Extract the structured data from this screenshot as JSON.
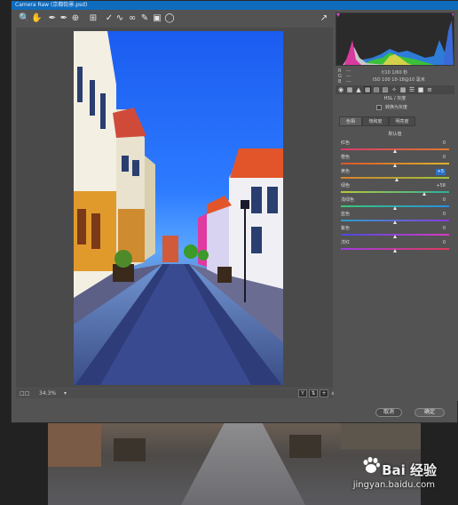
{
  "window": {
    "title": "Camera Raw (京都街景.psd)"
  },
  "toolbar": {
    "tools": [
      "zoom-tool",
      "hand-tool",
      "white-balance-tool",
      "color-sampler-tool",
      "target-adjust-tool",
      "crop-tool",
      "straighten-tool",
      "spot-removal-tool",
      "red-eye-tool",
      "adjustment-brush-tool",
      "graduated-filter-tool",
      "radial-filter-tool",
      "preferences-tool",
      "rotate-tool"
    ]
  },
  "status": {
    "zoom": "34.3%",
    "mode": "Y"
  },
  "info": {
    "r_label": "R",
    "g_label": "G",
    "b_label": "B",
    "r_value": "---",
    "g_value": "---",
    "b_value": "---",
    "camera": "f/10  1/60 秒",
    "lens": "ISO 100   10-18@10 毫米"
  },
  "panel": {
    "section_title": "HSL / 灰度",
    "convert_label": "转换为灰度",
    "subtabs": [
      "色相",
      "饱和度",
      "明亮度"
    ],
    "group_title": "默认值",
    "sliders": [
      {
        "label": "红色",
        "value": "0",
        "color_left": "#d83a6c",
        "color_right": "#e07a2c",
        "pos": 0.5
      },
      {
        "label": "橙色",
        "value": "0",
        "color_left": "#d8562c",
        "color_right": "#e0b32c",
        "pos": 0.5
      },
      {
        "label": "黄色",
        "value": "+5",
        "color_left": "#d8802c",
        "color_right": "#9ac83a",
        "pos": 0.52,
        "highlight": true
      },
      {
        "label": "绿色",
        "value": "+58",
        "color_left": "#b6c83a",
        "color_right": "#2cb0a0",
        "pos": 0.77
      },
      {
        "label": "浅绿色",
        "value": "0",
        "color_left": "#3ac87a",
        "color_right": "#2c8ce0",
        "pos": 0.5
      },
      {
        "label": "蓝色",
        "value": "0",
        "color_left": "#2ca0c8",
        "color_right": "#8a3ae0",
        "pos": 0.5
      },
      {
        "label": "紫色",
        "value": "0",
        "color_left": "#4a4ae0",
        "color_right": "#d83ac0",
        "pos": 0.5
      },
      {
        "label": "洋红",
        "value": "0",
        "color_left": "#a03ae0",
        "color_right": "#e03a5a",
        "pos": 0.5
      }
    ]
  },
  "buttons": {
    "cancel": "取消",
    "ok": "确定"
  },
  "watermark": {
    "brand": "Bai 经验",
    "url": "jingyan.baidu.com"
  },
  "colors": {
    "accent": "#2a72c9",
    "titlebar": "#0f6cbd",
    "panel_bg": "#535353"
  }
}
